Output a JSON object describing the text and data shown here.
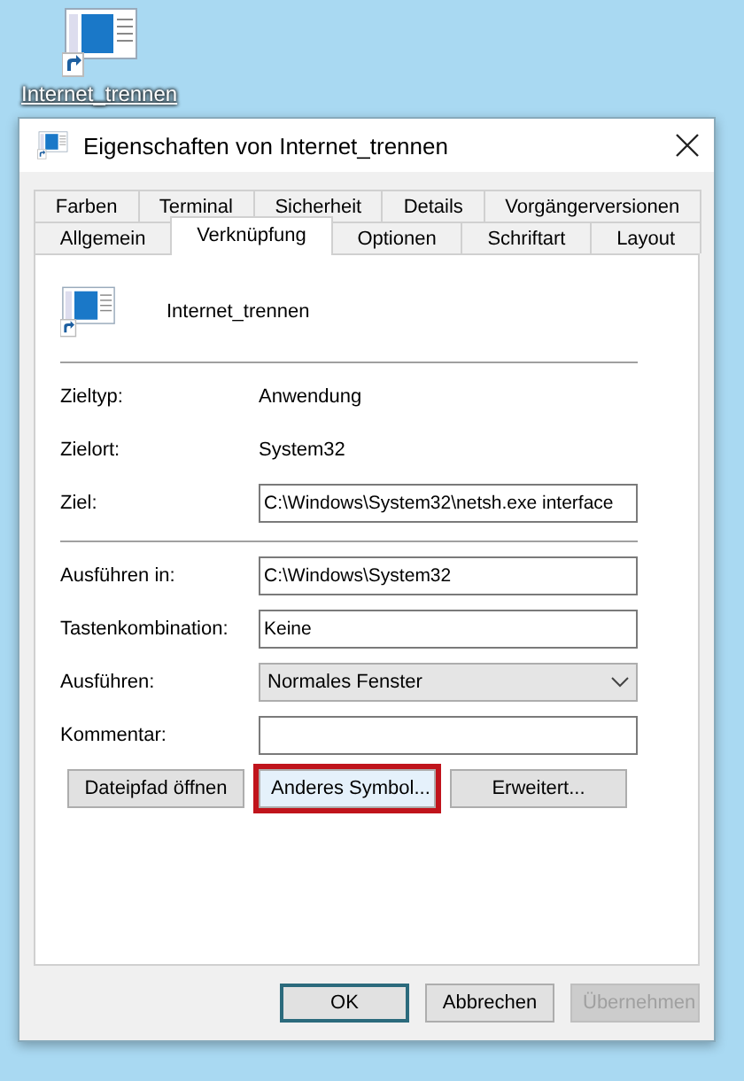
{
  "desktop_icon": {
    "label": "Internet_trennen"
  },
  "window": {
    "title": "Eigenschaften von Internet_trennen"
  },
  "tab_rows": [
    {
      "tabs": [
        {
          "label": "Farben",
          "selected": false
        },
        {
          "label": "Terminal",
          "selected": false
        },
        {
          "label": "Sicherheit",
          "selected": false
        },
        {
          "label": "Details",
          "selected": false
        },
        {
          "label": "Vorgängerversionen",
          "selected": false
        }
      ]
    },
    {
      "tabs": [
        {
          "label": "Allgemein",
          "selected": false
        },
        {
          "label": "Verknüpfung",
          "selected": true
        },
        {
          "label": "Optionen",
          "selected": false
        },
        {
          "label": "Schriftart",
          "selected": false
        },
        {
          "label": "Layout",
          "selected": false
        }
      ]
    }
  ],
  "shortcut_name": "Internet_trennen",
  "target_info": [
    {
      "kind": "text",
      "label": "Zieltyp:",
      "value": "Anwendung"
    },
    {
      "kind": "text",
      "label": "Zielort:",
      "value": "System32"
    },
    {
      "kind": "field",
      "label": "Ziel:",
      "value": "C:\\Windows\\System32\\netsh.exe interface"
    }
  ],
  "settings": [
    {
      "kind": "field",
      "label": "Ausführen in:",
      "value": "C:\\Windows\\System32"
    },
    {
      "kind": "field",
      "label": "Tastenkombination:",
      "value": "Keine"
    },
    {
      "kind": "combo",
      "label": "Ausführen:",
      "value": "Normales Fenster"
    },
    {
      "kind": "field",
      "label": "Kommentar:"
    }
  ],
  "actions": [
    {
      "label": "Dateipfad öffnen",
      "highlighted": false
    },
    {
      "label": "Anderes Symbol...",
      "highlighted": true
    },
    {
      "label": "Erweitert...",
      "highlighted": false
    }
  ],
  "footer_buttons": [
    {
      "label": "OK",
      "default": true,
      "disabled": false
    },
    {
      "label": "Abbrechen",
      "default": false,
      "disabled": false
    },
    {
      "label": "Übernehmen",
      "default": false,
      "disabled": true
    }
  ]
}
